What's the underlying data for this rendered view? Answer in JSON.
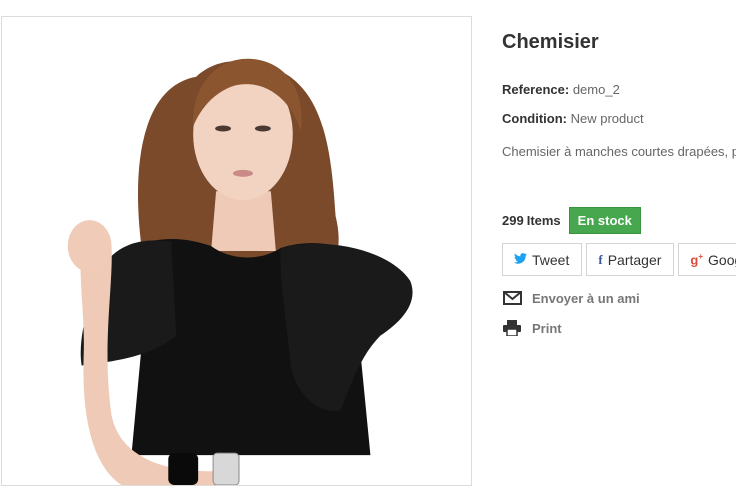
{
  "product": {
    "name": "Chemisier",
    "reference_label": "Reference:",
    "reference_value": "demo_2",
    "condition_label": "Condition:",
    "condition_value": "New product",
    "description": "Chemisier à manches courtes drapées, p élégant.",
    "quantity": "299",
    "quantity_label": "Items",
    "availability": "En stock"
  },
  "share": {
    "tweet": "Tweet",
    "facebook": "Partager",
    "google": "Googl"
  },
  "actions": {
    "send_to_friend": "Envoyer à un ami",
    "print": "Print"
  },
  "icons": {
    "twitter": "twitter-icon",
    "facebook": "facebook-icon",
    "google": "google-plus-icon",
    "envelope": "envelope-icon",
    "print": "printer-icon"
  },
  "colors": {
    "in_stock": "#46a74e",
    "twitter": "#1da1f2",
    "facebook": "#3b5998",
    "google_plus": "#dd4b39"
  }
}
